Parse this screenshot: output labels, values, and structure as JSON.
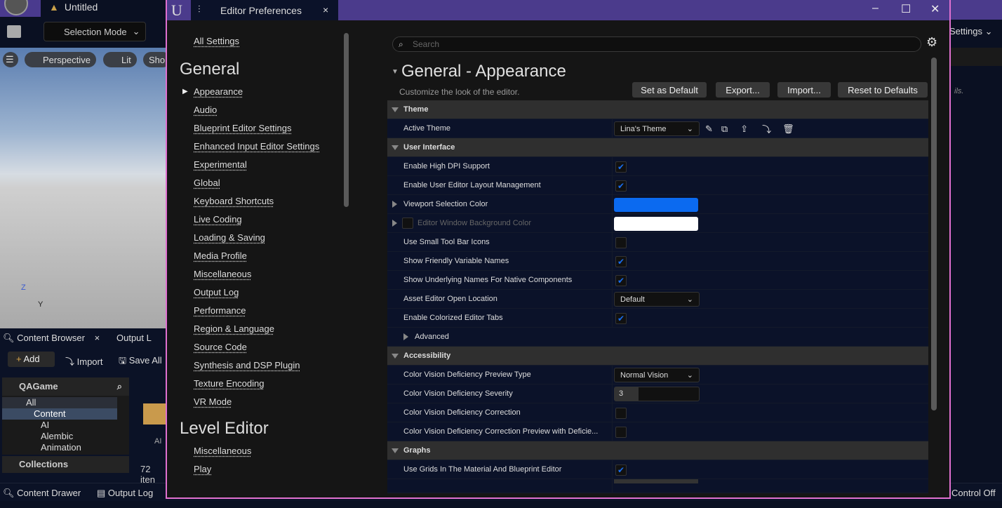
{
  "main": {
    "title": "Untitled",
    "selection_mode": "Selection Mode",
    "viewport": {
      "perspective": "Perspective",
      "lit": "Lit",
      "show": "Sho"
    },
    "axis": {
      "z": "Z",
      "y": "Y"
    },
    "content_browser": {
      "tab": "Content Browser",
      "output_tab": "Output L",
      "add": "Add",
      "import": "Import",
      "save_all": "Save All",
      "project": "QAGame",
      "tree": [
        "All",
        "Content",
        "AI",
        "Alembic",
        "Animation"
      ],
      "collections": "Collections",
      "folder_label": "AI",
      "item_count": "72 iten"
    },
    "bottom": {
      "content_drawer": "Content Drawer",
      "output_log": "Output Log",
      "control": "Control Off"
    },
    "right": {
      "settings": "Settings",
      "details_hint": "ils."
    }
  },
  "dialog": {
    "title": "Editor Preferences",
    "nav": {
      "all": "All Settings",
      "general": "General",
      "general_items": [
        "Appearance",
        "Audio",
        "Blueprint Editor Settings",
        "Enhanced Input Editor Settings",
        "Experimental",
        "Global",
        "Keyboard Shortcuts",
        "Live Coding",
        "Loading & Saving",
        "Media Profile",
        "Miscellaneous",
        "Output Log",
        "Performance",
        "Region & Language",
        "Source Code",
        "Synthesis and DSP Plugin",
        "Texture Encoding",
        "VR Mode"
      ],
      "level_editor": "Level Editor",
      "level_items": [
        "Miscellaneous",
        "Play"
      ]
    },
    "search_placeholder": "Search",
    "page_title": "General - Appearance",
    "page_subtitle": "Customize the look of the editor.",
    "buttons": {
      "set_default": "Set as Default",
      "export": "Export...",
      "import": "Import...",
      "reset": "Reset to Defaults"
    },
    "sections": {
      "theme": "Theme",
      "ui": "User Interface",
      "accessibility": "Accessibility",
      "graphs": "Graphs"
    },
    "rows": {
      "active_theme": {
        "label": "Active Theme",
        "value": "Lina's Theme"
      },
      "high_dpi": {
        "label": "Enable High DPI Support",
        "checked": true
      },
      "layout_mgmt": {
        "label": "Enable User Editor Layout Management",
        "checked": true
      },
      "sel_color": {
        "label": "Viewport Selection Color",
        "color": "#0b6af0"
      },
      "bg_color": {
        "label": "Editor Window Background Color",
        "color": "#ffffff"
      },
      "small_icons": {
        "label": "Use Small Tool Bar Icons",
        "checked": false
      },
      "friendly_names": {
        "label": "Show Friendly Variable Names",
        "checked": true
      },
      "underlying_names": {
        "label": "Show Underlying Names For Native Components",
        "checked": true
      },
      "open_location": {
        "label": "Asset Editor Open Location",
        "value": "Default"
      },
      "colorized_tabs": {
        "label": "Enable Colorized Editor Tabs",
        "checked": true
      },
      "advanced": {
        "label": "Advanced"
      },
      "cvd_type": {
        "label": "Color Vision Deficiency Preview Type",
        "value": "Normal Vision"
      },
      "cvd_severity": {
        "label": "Color Vision Deficiency Severity",
        "value": "3"
      },
      "cvd_correction": {
        "label": "Color Vision Deficiency Correction",
        "checked": false
      },
      "cvd_preview": {
        "label": "Color Vision Deficiency Correction Preview with Deficie...",
        "checked": false
      },
      "use_grids": {
        "label": "Use Grids In The Material And Blueprint Editor",
        "checked": true
      }
    }
  }
}
